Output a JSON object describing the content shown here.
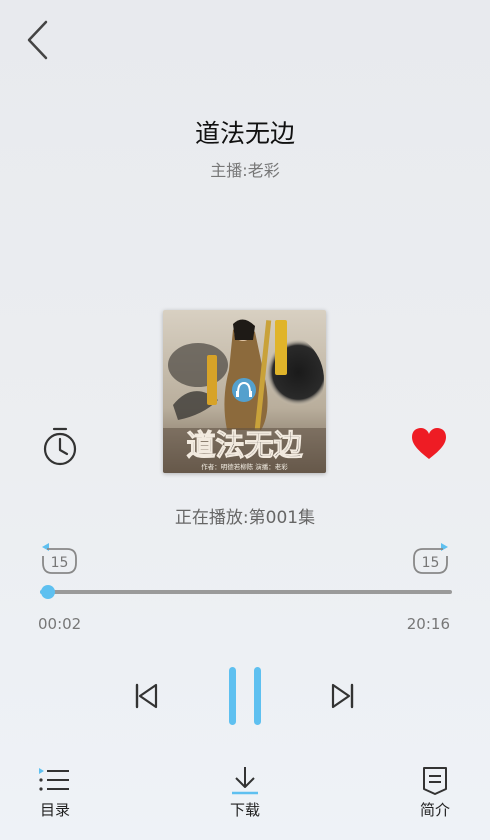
{
  "header": {
    "back_icon": "chevron-left-icon"
  },
  "album": {
    "title": "道法无边",
    "host_label": "主播:老彩",
    "cover_title": "道法无边",
    "cover_credits": "作者：明德若柳陈  演播：老彩"
  },
  "controls": {
    "timer_icon": "alarm-clock-icon",
    "favorite_icon": "heart-icon",
    "favorite_color": "#ee1c24",
    "now_playing": "正在播放:第001集",
    "rewind_label": "15",
    "forward_label": "15",
    "current_time": "00:02",
    "total_time": "20:16",
    "progress_fraction": 0.0017,
    "accent_color": "#5ec0f0"
  },
  "tabs": [
    {
      "label": "目录",
      "icon": "list-icon"
    },
    {
      "label": "下载",
      "icon": "download-icon"
    },
    {
      "label": "简介",
      "icon": "document-icon"
    }
  ]
}
